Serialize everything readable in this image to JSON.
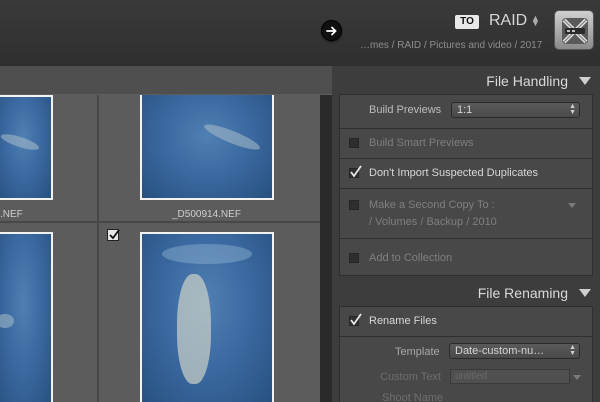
{
  "header": {
    "destination_badge": "TO",
    "destination_name": "RAID",
    "destination_path": "…mes / RAID / Pictures and video / 2017",
    "arrow_icon": "arrow-right-icon",
    "drive_icon": "raid-drive-icon"
  },
  "grid": {
    "cells": [
      {
        "filename": ".NEF",
        "checked": false
      },
      {
        "filename": "_D500914.NEF",
        "checked": false
      },
      {
        "filename": "",
        "checked": false
      },
      {
        "filename": "",
        "checked": true
      }
    ]
  },
  "file_handling": {
    "title": "File Handling",
    "build_previews_label": "Build Previews",
    "build_previews_value": "1:1",
    "build_smart_previews": {
      "label": "Build Smart Previews",
      "checked": false
    },
    "dont_import_duplicates": {
      "label": "Don't Import Suspected Duplicates",
      "checked": true
    },
    "second_copy": {
      "label": "Make a Second Copy To :",
      "path": "/ Volumes / Backup / 2010",
      "checked": false
    },
    "add_to_collection": {
      "label": "Add to Collection",
      "checked": false
    }
  },
  "file_renaming": {
    "title": "File Renaming",
    "rename_files": {
      "label": "Rename Files",
      "checked": true
    },
    "template_label": "Template",
    "template_value": "Date-custom-nu…",
    "custom_text_label": "Custom Text",
    "custom_text_placeholder": "untitled",
    "shoot_name_label": "Shoot Name"
  },
  "colors": {
    "panel_bg": "#3d3d3d",
    "section_box": "#484848",
    "thumb_water": "#3b6aa2",
    "text_active": "#d8d8d8",
    "text_dim": "#7f7f7f"
  }
}
